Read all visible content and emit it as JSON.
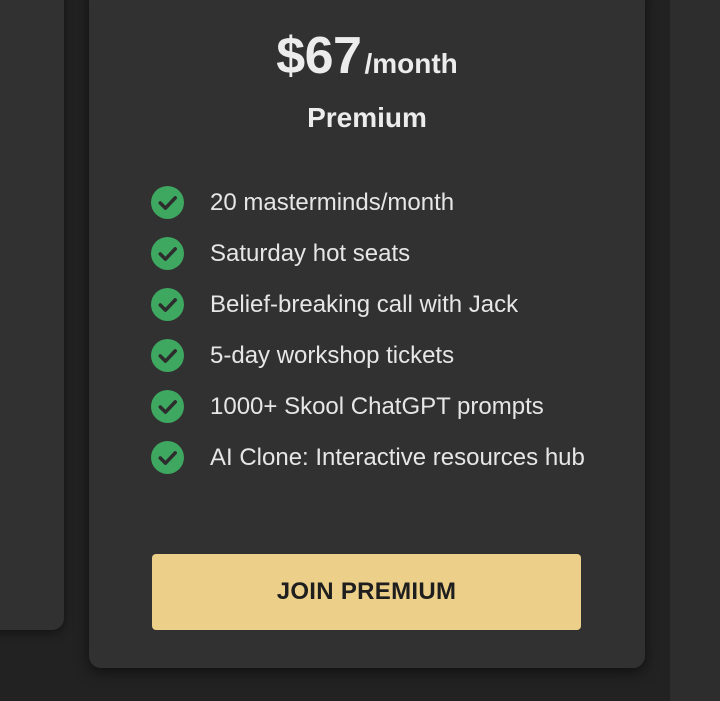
{
  "plan": {
    "price": "$67",
    "period": "/month",
    "name": "Premium",
    "features": [
      "20 masterminds/month",
      "Saturday hot seats",
      "Belief-breaking call with Jack",
      "5-day workshop tickets",
      "1000+ Skool ChatGPT prompts",
      "AI Clone: Interactive resources hub"
    ],
    "button_label": "JOIN PREMIUM"
  },
  "icons": {
    "feature_check": "check-circle-icon"
  },
  "colors": {
    "background": "#222222",
    "card": "#313131",
    "check_green": "#3ea760",
    "button": "#ecd08a",
    "button_text": "#1e1e1e",
    "text": "#ececec"
  }
}
